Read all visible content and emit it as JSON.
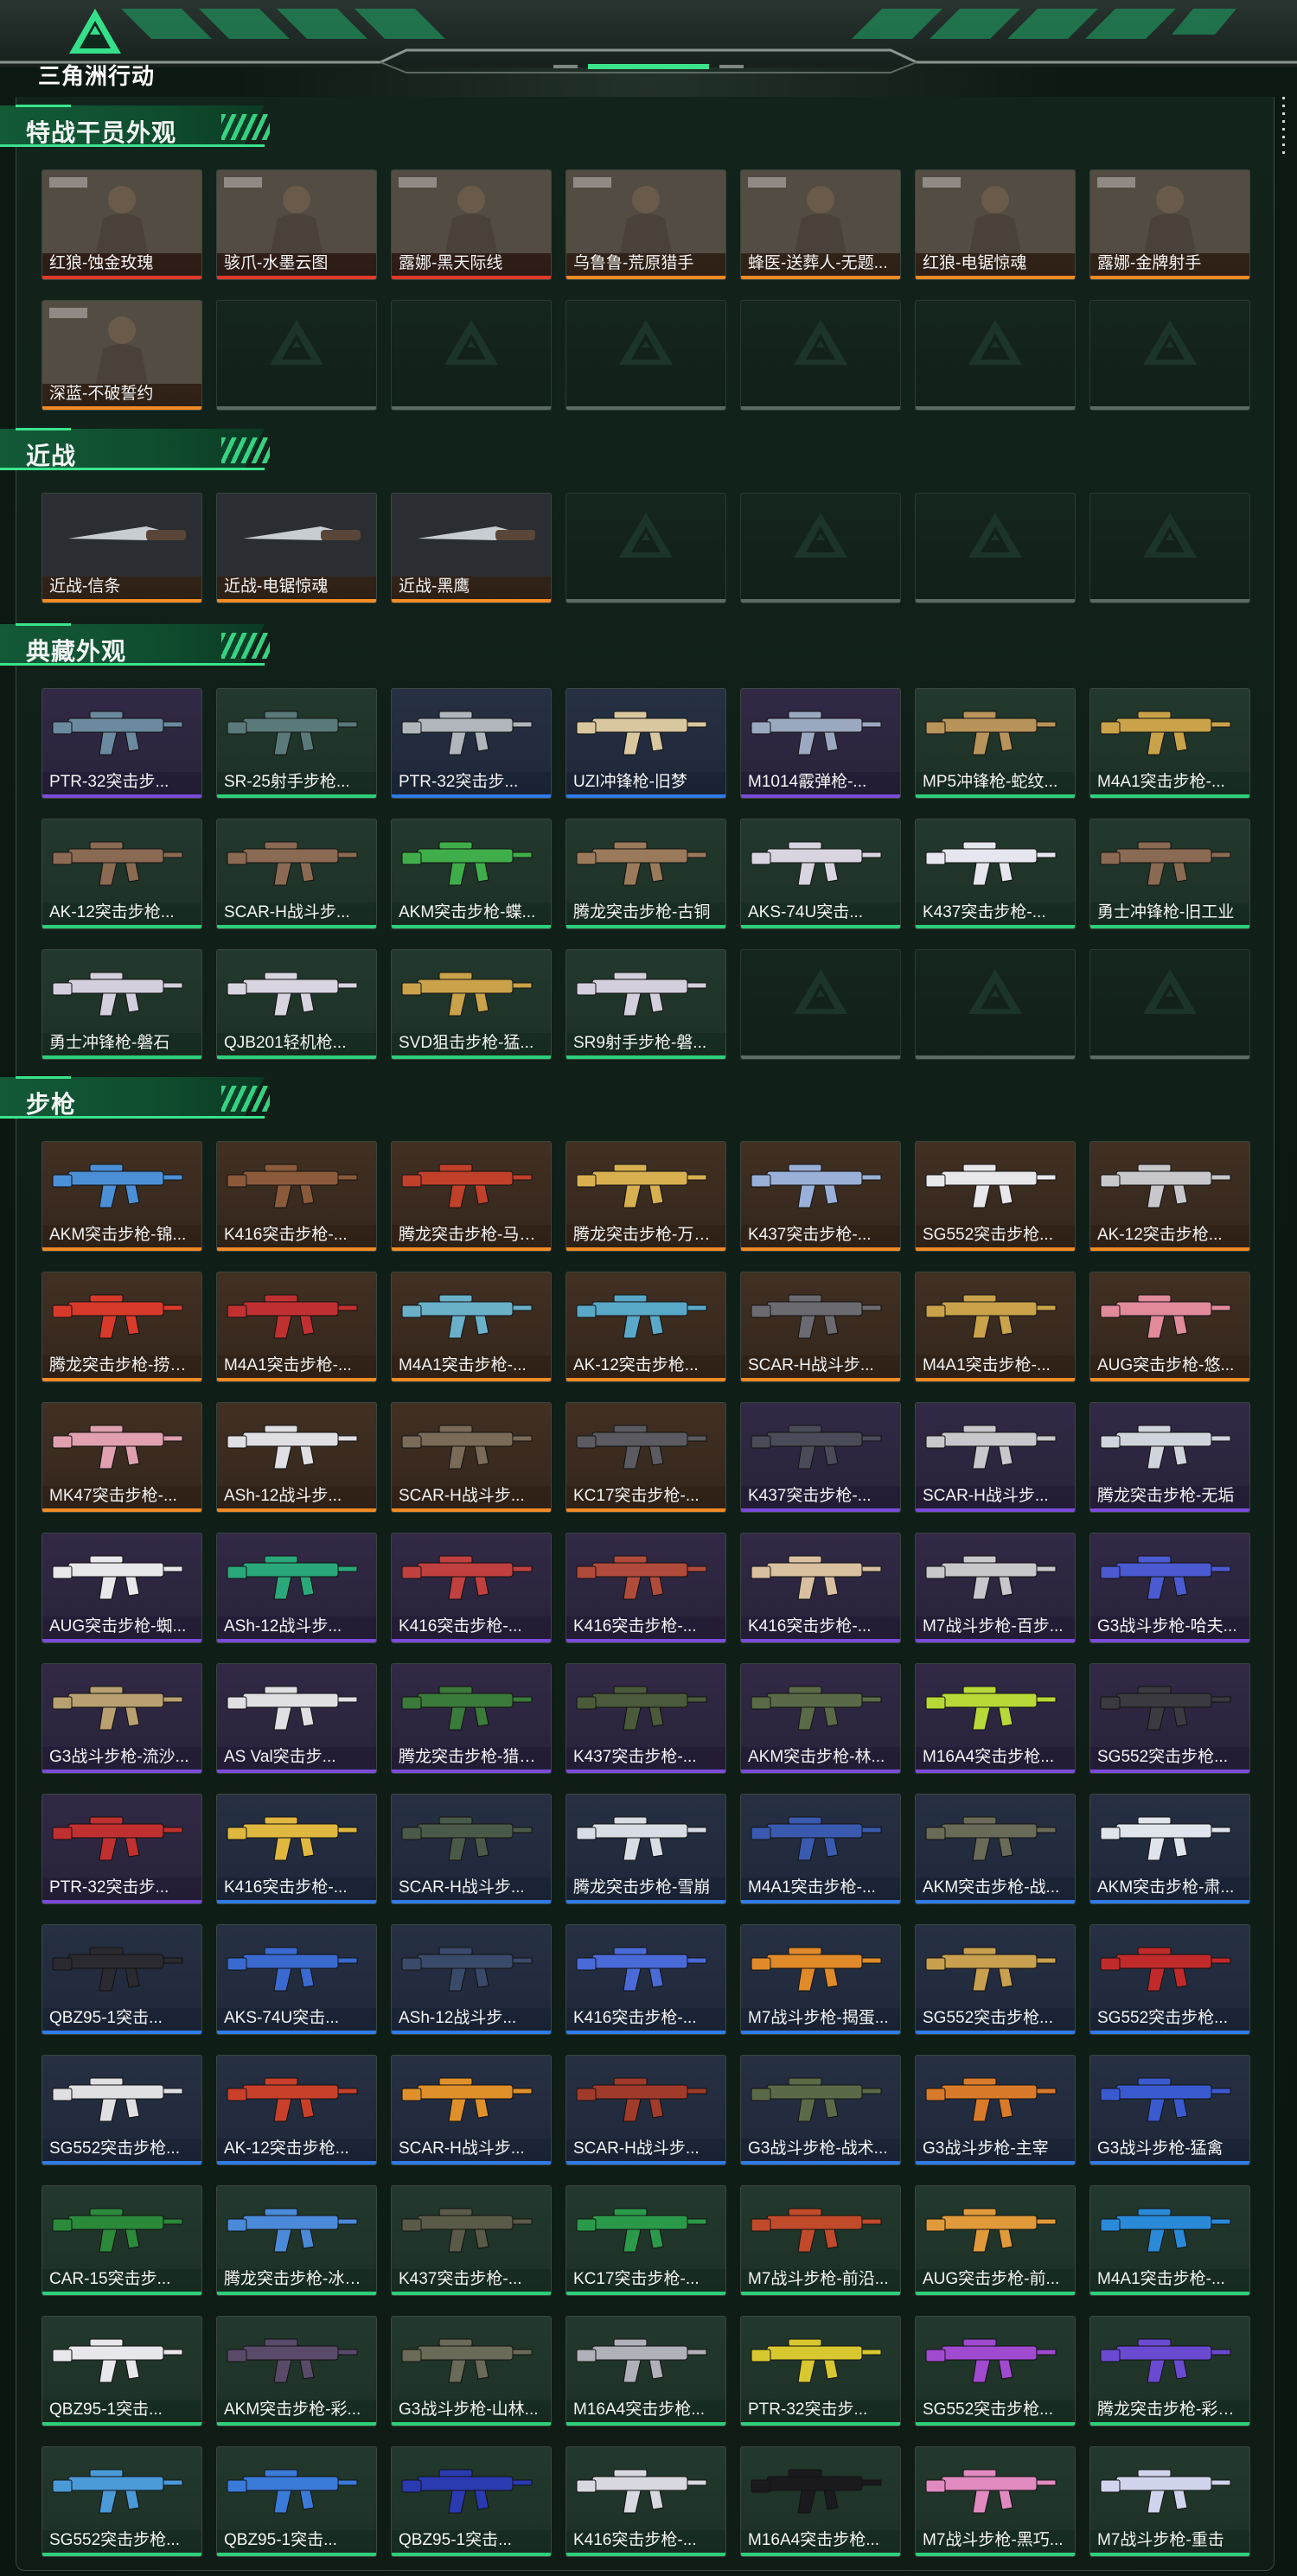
{
  "app": {
    "logo_text": "三角洲行动"
  },
  "colors": {
    "accent": "#3be38c",
    "red": "#e03a2a",
    "orange": "#f08a24",
    "purple": "#7b4bd9",
    "blue": "#2f7be8",
    "green": "#2ecf7a"
  },
  "sections": [
    {
      "title": "特战干员外观",
      "items": [
        {
          "label": "红狼-蚀金玫瑰",
          "rarity": "red",
          "art": "operator"
        },
        {
          "label": "骇爪-水墨云图",
          "rarity": "red",
          "art": "operator"
        },
        {
          "label": "露娜-黑天际线",
          "rarity": "red",
          "art": "operator"
        },
        {
          "label": "乌鲁鲁-荒原猎手",
          "rarity": "orange",
          "art": "operator"
        },
        {
          "label": "蜂医-送葬人-无题...",
          "rarity": "orange",
          "art": "operator"
        },
        {
          "label": "红狼-电锯惊魂",
          "rarity": "orange",
          "art": "operator"
        },
        {
          "label": "露娜-金牌射手",
          "rarity": "orange",
          "art": "operator"
        },
        {
          "label": "深蓝-不破誓约",
          "rarity": "orange",
          "art": "operator"
        },
        {
          "empty": true
        },
        {
          "empty": true
        },
        {
          "empty": true
        },
        {
          "empty": true
        },
        {
          "empty": true
        },
        {
          "empty": true
        }
      ]
    },
    {
      "title": "近战",
      "items": [
        {
          "label": "近战-信条",
          "rarity": "orange",
          "art": "knife"
        },
        {
          "label": "近战-电锯惊魂",
          "rarity": "orange",
          "art": "knife"
        },
        {
          "label": "近战-黑鹰",
          "rarity": "orange",
          "art": "knife"
        },
        {
          "empty": true
        },
        {
          "empty": true
        },
        {
          "empty": true
        },
        {
          "empty": true
        }
      ]
    },
    {
      "title": "典藏外观",
      "items": [
        {
          "label": "PTR-32突击步...",
          "rarity": "purple",
          "art": "#6b8aa0"
        },
        {
          "label": "SR-25射手步枪...",
          "rarity": "green",
          "art": "#5a7a7a"
        },
        {
          "label": "PTR-32突击步...",
          "rarity": "blue",
          "art": "#b0b6bc"
        },
        {
          "label": "UZI冲锋枪-旧梦",
          "rarity": "blue",
          "art": "#d9c7a0"
        },
        {
          "label": "M1014霰弹枪-...",
          "rarity": "purple",
          "art": "#9aa8c0"
        },
        {
          "label": "MP5冲锋枪-蛇纹...",
          "rarity": "green",
          "art": "#b8935a"
        },
        {
          "label": "M4A1突击步枪-...",
          "rarity": "green",
          "art": "#c9a24a"
        },
        {
          "label": "AK-12突击步枪...",
          "rarity": "green",
          "art": "#8a6a52"
        },
        {
          "label": "SCAR-H战斗步...",
          "rarity": "green",
          "art": "#8a6a52"
        },
        {
          "label": "AKM突击步枪-蝶...",
          "rarity": "green",
          "art": "#3fae4a"
        },
        {
          "label": "腾龙突击步枪-古铜",
          "rarity": "green",
          "art": "#9a7a5a"
        },
        {
          "label": "AKS-74U突击...",
          "rarity": "green",
          "art": "#d8d4e0"
        },
        {
          "label": "K437突击步枪-...",
          "rarity": "green",
          "art": "#e6e6ee"
        },
        {
          "label": "勇士冲锋枪-旧工业",
          "rarity": "green",
          "art": "#8a6a52"
        },
        {
          "label": "勇士冲锋枪-磐石",
          "rarity": "green",
          "art": "#d4cfdc"
        },
        {
          "label": "QJB201轻机枪...",
          "rarity": "green",
          "art": "#d8d4e0"
        },
        {
          "label": "SVD狙击步枪-猛...",
          "rarity": "green",
          "art": "#c9a24a"
        },
        {
          "label": "SR9射手步枪-磐...",
          "rarity": "green",
          "art": "#d4cfdc"
        },
        {
          "empty": true
        },
        {
          "empty": true
        },
        {
          "empty": true
        }
      ]
    },
    {
      "title": "步枪",
      "items": [
        {
          "label": "AKM突击步枪-锦...",
          "rarity": "orange",
          "art": "#4b8fd6"
        },
        {
          "label": "K416突击步枪-...",
          "rarity": "orange",
          "art": "#8a5a3a"
        },
        {
          "label": "腾龙突击步枪-马年...",
          "rarity": "orange",
          "art": "#c0402a"
        },
        {
          "label": "腾龙突击步枪-万金...",
          "rarity": "orange",
          "art": "#d8b050"
        },
        {
          "label": "K437突击步枪-...",
          "rarity": "orange",
          "art": "#9ab0d8"
        },
        {
          "label": "SG552突击步枪...",
          "rarity": "orange",
          "art": "#e8e8ec"
        },
        {
          "label": "AK-12突击步枪...",
          "rarity": "orange",
          "art": "#c8c8cc"
        },
        {
          "label": "腾龙突击步枪-捞点...",
          "rarity": "orange",
          "art": "#d83a2a"
        },
        {
          "label": "M4A1突击步枪-...",
          "rarity": "orange",
          "art": "#c03030"
        },
        {
          "label": "M4A1突击步枪-...",
          "rarity": "orange",
          "art": "#6ab0c8"
        },
        {
          "label": "AK-12突击步枪...",
          "rarity": "orange",
          "art": "#5aa8c8"
        },
        {
          "label": "SCAR-H战斗步...",
          "rarity": "orange",
          "art": "#6a6a70"
        },
        {
          "label": "M4A1突击步枪-...",
          "rarity": "orange",
          "art": "#c9a24a"
        },
        {
          "label": "AUG突击步枪-悠...",
          "rarity": "orange",
          "art": "#e08a9a"
        },
        {
          "label": "MK47突击步枪-...",
          "rarity": "orange",
          "art": "#e0a0b0"
        },
        {
          "label": "ASh-12战斗步...",
          "rarity": "orange",
          "art": "#e0e0e4"
        },
        {
          "label": "SCAR-H战斗步...",
          "rarity": "orange",
          "art": "#7a6a58"
        },
        {
          "label": "KC17突击步枪-...",
          "rarity": "orange",
          "art": "#5a5a60"
        },
        {
          "label": "K437突击步枪-...",
          "rarity": "purple",
          "art": "#4a4a58"
        },
        {
          "label": "SCAR-H战斗步...",
          "rarity": "purple",
          "art": "#c8c8cc"
        },
        {
          "label": "腾龙突击步枪-无垢",
          "rarity": "purple",
          "art": "#d0d4dc"
        },
        {
          "label": "AUG突击步枪-蜘...",
          "rarity": "purple",
          "art": "#e8e8ec"
        },
        {
          "label": "ASh-12战斗步...",
          "rarity": "purple",
          "art": "#2aa87a"
        },
        {
          "label": "K416突击步枪-...",
          "rarity": "purple",
          "art": "#c04040"
        },
        {
          "label": "K416突击步枪-...",
          "rarity": "purple",
          "art": "#b04a3a"
        },
        {
          "label": "K416突击步枪-...",
          "rarity": "purple",
          "art": "#d8c0a0"
        },
        {
          "label": "M7战斗步枪-百步...",
          "rarity": "purple",
          "art": "#c8c8cc"
        },
        {
          "label": "G3战斗步枪-哈夫...",
          "rarity": "purple",
          "art": "#4a5ad0"
        },
        {
          "label": "G3战斗步枪-流沙...",
          "rarity": "purple",
          "art": "#b8a070"
        },
        {
          "label": "AS Val突击步...",
          "rarity": "purple",
          "art": "#e0e0e4"
        },
        {
          "label": "腾龙突击步枪-猎鳄...",
          "rarity": "purple",
          "art": "#3a7a3a"
        },
        {
          "label": "K437突击步枪-...",
          "rarity": "purple",
          "art": "#4a5a3a"
        },
        {
          "label": "AKM突击步枪-林...",
          "rarity": "purple",
          "art": "#5a6a48"
        },
        {
          "label": "M16A4突击步枪...",
          "rarity": "purple",
          "art": "#b8d838"
        },
        {
          "label": "SG552突击步枪...",
          "rarity": "purple",
          "art": "#3a3a40"
        },
        {
          "label": "PTR-32突击步...",
          "rarity": "purple",
          "art": "#c03030"
        },
        {
          "label": "K416突击步枪-...",
          "rarity": "blue",
          "art": "#e0b840"
        },
        {
          "label": "SCAR-H战斗步...",
          "rarity": "blue",
          "art": "#4a5a48"
        },
        {
          "label": "腾龙突击步枪-雪崩",
          "rarity": "blue",
          "art": "#d8dce4"
        },
        {
          "label": "M4A1突击步枪-...",
          "rarity": "blue",
          "art": "#3a5ab0"
        },
        {
          "label": "AKM突击步枪-战...",
          "rarity": "blue",
          "art": "#6a6a58"
        },
        {
          "label": "AKM突击步枪-肃...",
          "rarity": "blue",
          "art": "#e0e4ec"
        },
        {
          "label": "QBZ95-1突击...",
          "rarity": "blue",
          "art": "#2a2a30"
        },
        {
          "label": "AKS-74U突击...",
          "rarity": "blue",
          "art": "#3a6ad0"
        },
        {
          "label": "ASh-12战斗步...",
          "rarity": "blue",
          "art": "#3a4a6a"
        },
        {
          "label": "K416突击步枪-...",
          "rarity": "blue",
          "art": "#4a6ad8"
        },
        {
          "label": "M7战斗步枪-揭蛋...",
          "rarity": "blue",
          "art": "#e08a2a"
        },
        {
          "label": "SG552突击步枪...",
          "rarity": "blue",
          "art": "#c8a050"
        },
        {
          "label": "SG552突击步枪...",
          "rarity": "blue",
          "art": "#c02a2a"
        },
        {
          "label": "SG552突击步枪...",
          "rarity": "blue",
          "art": "#e0e0e4"
        },
        {
          "label": "AK-12突击步枪...",
          "rarity": "blue",
          "art": "#c8402a"
        },
        {
          "label": "SCAR-H战斗步...",
          "rarity": "blue",
          "art": "#e0902a"
        },
        {
          "label": "SCAR-H战斗步...",
          "rarity": "blue",
          "art": "#a03a2a"
        },
        {
          "label": "G3战斗步枪-战术...",
          "rarity": "blue",
          "art": "#5a6a48"
        },
        {
          "label": "G3战斗步枪-主宰",
          "rarity": "blue",
          "art": "#d87a2a"
        },
        {
          "label": "G3战斗步枪-猛禽",
          "rarity": "blue",
          "art": "#3a5ad0"
        },
        {
          "label": "CAR-15突击步...",
          "rarity": "green",
          "art": "#2a8a3a"
        },
        {
          "label": "腾龙突击步枪-冰天...",
          "rarity": "green",
          "art": "#4a8ad8"
        },
        {
          "label": "K437突击步枪-...",
          "rarity": "green",
          "art": "#5a5a48"
        },
        {
          "label": "KC17突击步枪-...",
          "rarity": "green",
          "art": "#2a9a4a"
        },
        {
          "label": "M7战斗步枪-前沿...",
          "rarity": "green",
          "art": "#c04a2a"
        },
        {
          "label": "AUG突击步枪-前...",
          "rarity": "green",
          "art": "#e09a3a"
        },
        {
          "label": "M4A1突击步枪-...",
          "rarity": "green",
          "art": "#2a8ad8"
        },
        {
          "label": "QBZ95-1突击...",
          "rarity": "green",
          "art": "#e8e8ec"
        },
        {
          "label": "AKM突击步枪-彩...",
          "rarity": "green",
          "art": "#5a4a6a"
        },
        {
          "label": "G3战斗步枪-山林...",
          "rarity": "green",
          "art": "#6a6a58"
        },
        {
          "label": "M16A4突击步枪...",
          "rarity": "green",
          "art": "#b0b0b8"
        },
        {
          "label": "PTR-32突击步...",
          "rarity": "green",
          "art": "#d8c830"
        },
        {
          "label": "SG552突击步枪...",
          "rarity": "green",
          "art": "#a04ad0"
        },
        {
          "label": "腾龙突击步枪-彩墨...",
          "rarity": "green",
          "art": "#6a4ad0"
        },
        {
          "label": "SG552突击步枪...",
          "rarity": "green",
          "art": "#4a9ad8"
        },
        {
          "label": "QBZ95-1突击...",
          "rarity": "green",
          "art": "#3a7ad8"
        },
        {
          "label": "QBZ95-1突击...",
          "rarity": "green",
          "art": "#2a3ab0"
        },
        {
          "label": "K416突击步枪-...",
          "rarity": "green",
          "art": "#d8d8e0"
        },
        {
          "label": "M16A4突击步枪...",
          "rarity": "green",
          "art": "#1a1a1e"
        },
        {
          "label": "M7战斗步枪-黑巧...",
          "rarity": "green",
          "art": "#e08ac0"
        },
        {
          "label": "M7战斗步枪-重击",
          "rarity": "green",
          "art": "#d0d4ec"
        }
      ]
    }
  ]
}
